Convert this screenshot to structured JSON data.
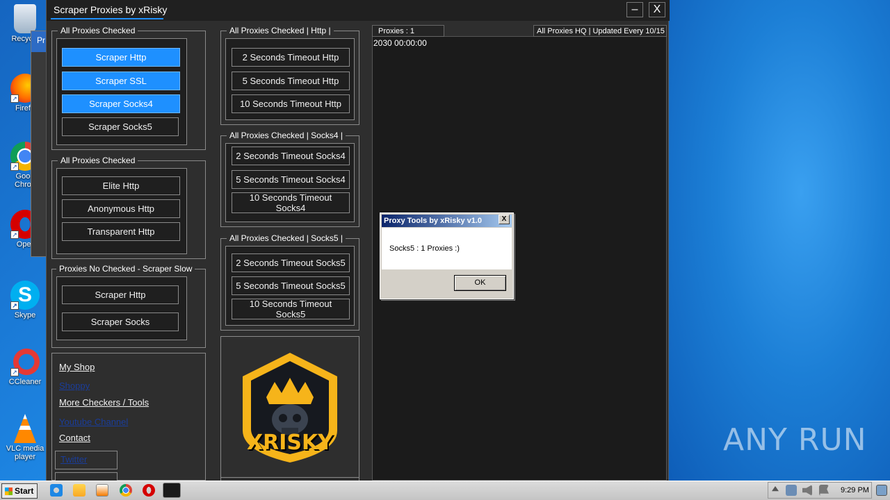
{
  "window": {
    "title": "Scraper Proxies by xRisky",
    "minimize_glyph": "–",
    "close_glyph": "X"
  },
  "background_window": {
    "title_fragment": "Pr"
  },
  "group_all_checked_1": {
    "label": "All Proxies Checked",
    "buttons": [
      "Scraper Http",
      "Scraper SSL",
      "Scraper Socks4",
      "Scraper Socks5"
    ]
  },
  "group_all_checked_2": {
    "label": "All Proxies Checked",
    "buttons": [
      "Elite Http",
      "Anonymous Http",
      "Transparent Http"
    ]
  },
  "group_no_checked": {
    "label": "Proxies No Checked - Scraper Slow",
    "buttons": [
      "Scraper Http",
      "Scraper Socks"
    ]
  },
  "links": {
    "my_shop": "My Shop",
    "shoppy": "Shoppy",
    "more_checkers": "More Checkers / Tools",
    "youtube": "Youtube Channel",
    "contact": "Contact",
    "twitter": "Twitter"
  },
  "group_http": {
    "label": "All Proxies Checked | Http |",
    "buttons": [
      "2 Seconds Timeout Http",
      "5 Seconds Timeout Http",
      "10 Seconds Timeout Http"
    ]
  },
  "group_socks4": {
    "label": "All Proxies Checked | Socks4 |",
    "buttons": [
      "2 Seconds Timeout Socks4",
      "5 Seconds Timeout Socks4",
      "10 Seconds Timeout Socks4"
    ]
  },
  "group_socks5": {
    "label": "All Proxies Checked | Socks5 |",
    "buttons": [
      "2 Seconds Timeout Socks5",
      "5 Seconds Timeout Socks5",
      "10 Seconds Timeout Socks5"
    ]
  },
  "logo": {
    "text": "XRISKY"
  },
  "status": {
    "proxies": "Proxies : 1",
    "updated": "All Proxies HQ | Updated Every 10/15"
  },
  "log": {
    "line1": "2030 00:00:00"
  },
  "dialog": {
    "title": "Proxy Tools by xRisky v1.0",
    "message": "Socks5 :  1 Proxies :)",
    "ok": "OK",
    "close_glyph": "X"
  },
  "desktop_icons": [
    {
      "label": "Recycle",
      "icon": "recycle-bin-icon"
    },
    {
      "label": "Firefo",
      "icon": "firefox-icon"
    },
    {
      "label": "Goog Chron",
      "icon": "chrome-icon"
    },
    {
      "label": "Oper",
      "icon": "opera-icon"
    },
    {
      "label": "Skype",
      "icon": "skype-icon"
    },
    {
      "label": "CCleaner",
      "icon": "ccleaner-icon"
    },
    {
      "label": "VLC media player",
      "icon": "vlc-icon"
    }
  ],
  "watermark": "ANY RUN",
  "taskbar": {
    "start": "Start",
    "clock": "9:29 PM"
  },
  "colors": {
    "accent": "#1e90ff",
    "window_bg": "#2e2e2e",
    "dialog_title": "#0a246a"
  }
}
